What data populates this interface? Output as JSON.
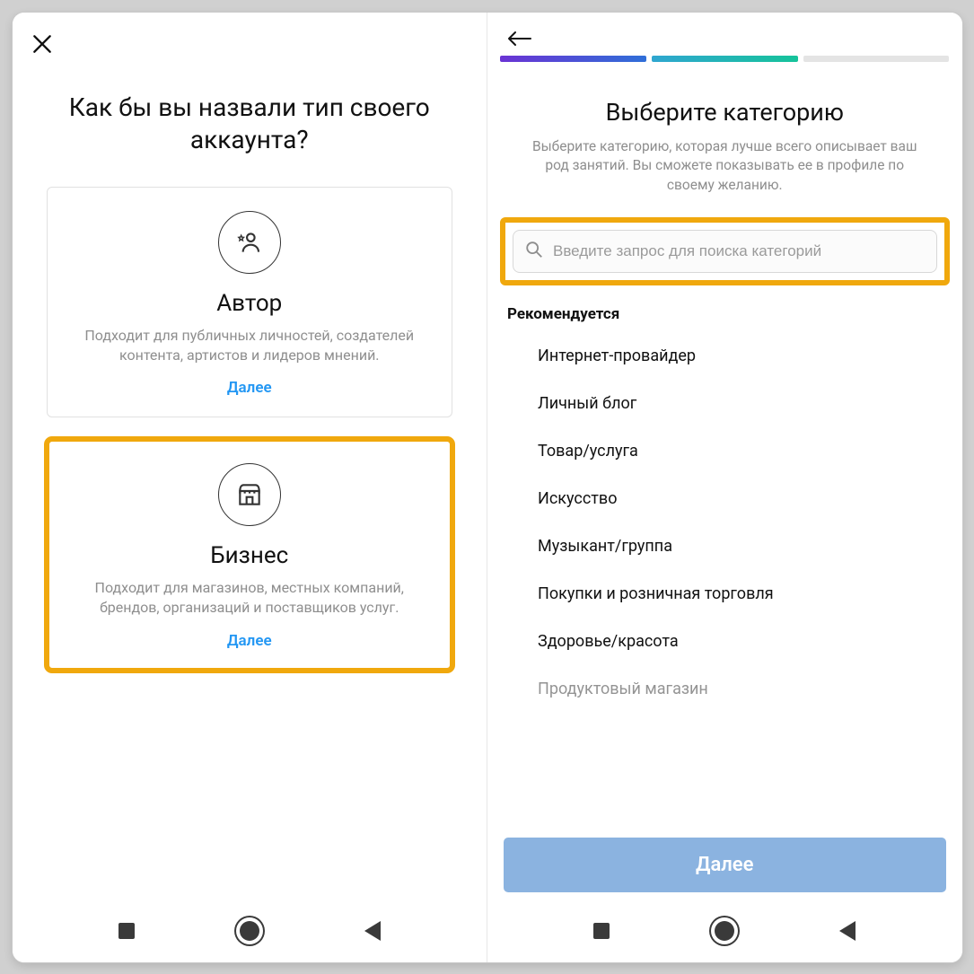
{
  "left": {
    "title": "Как бы вы назвали тип своего аккаунта?",
    "cards": [
      {
        "title": "Автор",
        "desc": "Подходит для публичных личностей, создателей контента, артистов и лидеров мнений.",
        "cta": "Далее"
      },
      {
        "title": "Бизнес",
        "desc": "Подходит для магазинов, местных компаний, брендов, организаций и поставщиков услуг.",
        "cta": "Далее"
      }
    ]
  },
  "right": {
    "title": "Выберите категорию",
    "subtitle": "Выберите категорию, которая лучше всего описывает ваш род занятий. Вы сможете показывать ее в профиле по своему желанию.",
    "search_placeholder": "Введите запрос для поиска категорий",
    "recommended_label": "Рекомендуется",
    "categories": [
      "Интернет-провайдер",
      "Личный блог",
      "Товар/услуга",
      "Искусство",
      "Музыкант/группа",
      "Покупки и розничная торговля",
      "Здоровье/красота",
      "Продуктовый магазин"
    ],
    "next_label": "Далее"
  },
  "highlight_color": "#f0a80d"
}
